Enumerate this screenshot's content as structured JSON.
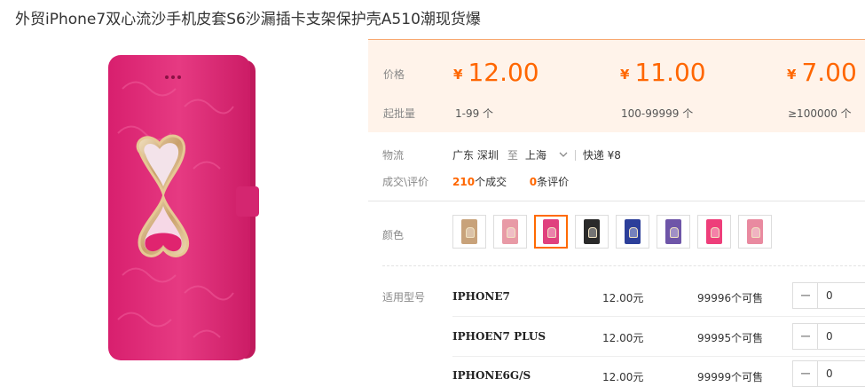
{
  "title": "外贸iPhone7双心流沙手机皮套S6沙漏插卡支架保护壳A510潮现货爆",
  "pricing": {
    "price_label": "价格",
    "batch_label": "起批量",
    "currency": "¥",
    "tiers": [
      {
        "price": "12.00",
        "range": "1-99 个"
      },
      {
        "price": "11.00",
        "range": "100-99999 个"
      },
      {
        "price": "7.00",
        "range": "≥100000 个"
      }
    ]
  },
  "logistics": {
    "label": "物流",
    "origin": "广东 深圳",
    "to_label": "至",
    "destination": "上海",
    "shipping": "快递 ¥8"
  },
  "deals": {
    "label": "成交\\评价",
    "deal_count": "210",
    "deal_suffix": "个成交",
    "review_count": "0",
    "review_suffix": "条评价"
  },
  "colors": {
    "label": "颜色",
    "swatches": [
      {
        "name": "tan",
        "hex": "#c8a27a",
        "selected": false
      },
      {
        "name": "light-pink",
        "hex": "#e89aa6",
        "selected": false
      },
      {
        "name": "rose",
        "hex": "#e0407e",
        "selected": true
      },
      {
        "name": "black",
        "hex": "#2a2a2a",
        "selected": false
      },
      {
        "name": "blue",
        "hex": "#2c3f9a",
        "selected": false
      },
      {
        "name": "purple",
        "hex": "#6e55a8",
        "selected": false
      },
      {
        "name": "hot-pink",
        "hex": "#ee3e7a",
        "selected": false
      },
      {
        "name": "pink",
        "hex": "#e98aa0",
        "selected": false
      }
    ]
  },
  "models": {
    "label": "适用型号",
    "rows": [
      {
        "name": "IPHONE7",
        "price": "12.00元",
        "stock": "99996个可售",
        "qty": "0"
      },
      {
        "name": "IPHOEN7 PLUS",
        "price": "12.00元",
        "stock": "99995个可售",
        "qty": "0"
      },
      {
        "name": "IPHONE6G/S",
        "price": "12.00元",
        "stock": "99999个可售",
        "qty": "0"
      }
    ]
  },
  "accent_color": "#ff6600"
}
